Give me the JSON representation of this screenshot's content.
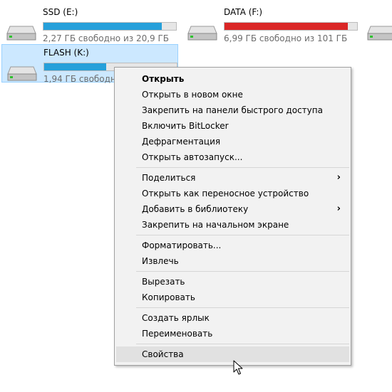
{
  "drives": [
    {
      "name": "SSD (E:)",
      "info": "2,27 ГБ свободно из 20,9 ГБ",
      "used_fraction": 0.89,
      "bar_color": "#26a0da",
      "selected": false
    },
    {
      "name": "DATA (F:)",
      "info": "6,99 ГБ свободно из 101 ГБ",
      "used_fraction": 0.93,
      "bar_color": "#da2626",
      "selected": false
    },
    {
      "name": "FLASH (K:)",
      "info": "1,94 ГБ свободно из",
      "used_fraction": 0.47,
      "bar_color": "#26a0da",
      "selected": true
    }
  ],
  "drive_icon": "hard-drive-icon",
  "menu": {
    "items": [
      {
        "label": "Открыть",
        "bold": true
      },
      {
        "label": "Открыть в новом окне"
      },
      {
        "label": "Закрепить на панели быстрого доступа"
      },
      {
        "label": "Включить BitLocker"
      },
      {
        "label": "Дефрагментация"
      },
      {
        "label": "Открыть автозапуск..."
      },
      {
        "separator": true
      },
      {
        "label": "Поделиться",
        "submenu": true
      },
      {
        "label": "Открыть как переносное устройство"
      },
      {
        "label": "Добавить в библиотеку",
        "submenu": true
      },
      {
        "label": "Закрепить на начальном экране"
      },
      {
        "separator": true
      },
      {
        "label": "Форматировать..."
      },
      {
        "label": "Извлечь"
      },
      {
        "separator": true
      },
      {
        "label": "Вырезать"
      },
      {
        "label": "Копировать"
      },
      {
        "separator": true
      },
      {
        "label": "Создать ярлык"
      },
      {
        "label": "Переименовать"
      },
      {
        "separator": true
      },
      {
        "label": "Свойства",
        "hover": true
      }
    ],
    "submenu_arrow": "›"
  },
  "colors": {
    "selection_bg": "#cce8ff",
    "selection_border": "#99d1ff",
    "menu_bg": "#f2f2f2",
    "hover_bg": "#e1e1e1"
  }
}
